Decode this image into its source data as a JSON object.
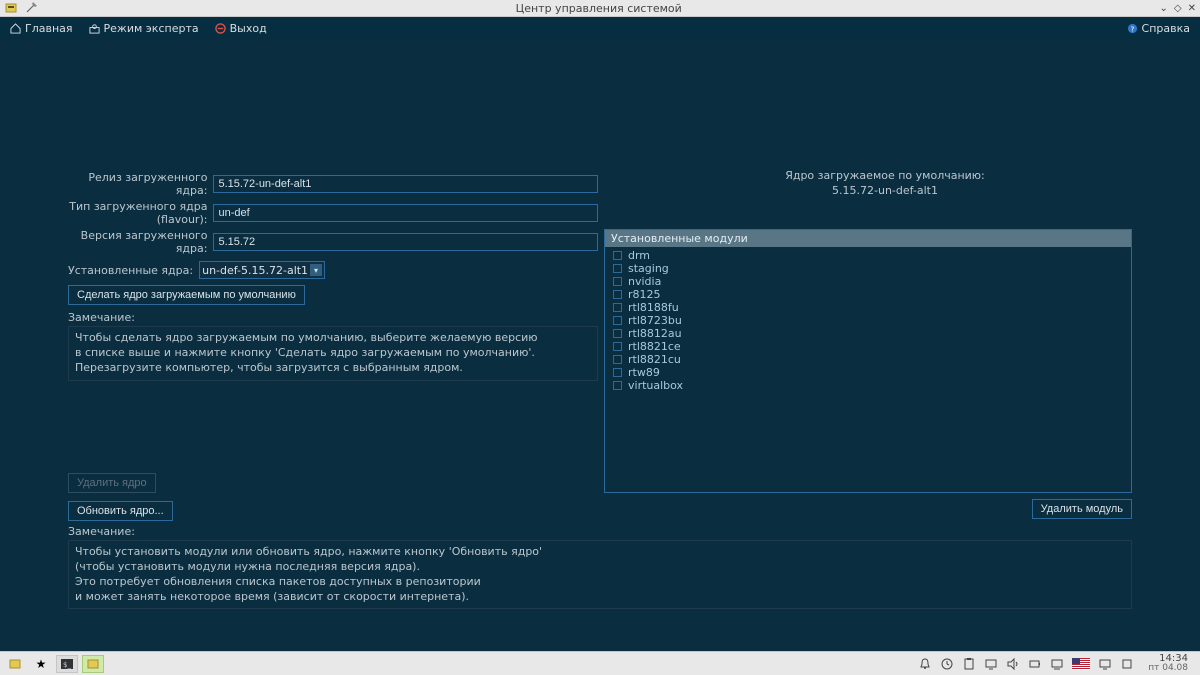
{
  "window": {
    "title": "Центр управления системой"
  },
  "menubar": {
    "home": "Главная",
    "expert": "Режим эксперта",
    "exit": "Выход",
    "help": "Справка"
  },
  "kernel": {
    "release_label": "Релиз загруженного ядра:",
    "release_value": "5.15.72-un-def-alt1",
    "flavour_label": "Тип загруженного ядра (flavour):",
    "flavour_value": "un-def",
    "version_label": "Версия загруженного ядра:",
    "version_value": "5.15.72",
    "installed_label": "Установленные ядра:",
    "installed_selected": "un-def-5.15.72-alt1",
    "make_default": "Сделать ядро загружаемым по умолчанию",
    "note_label": "Замечание:",
    "note_line1": "Чтобы сделать ядро загружаемым по умолчанию, выберите желаемую версию",
    "note_line2": "в списке выше и нажмите кнопку 'Сделать ядро загружаемым по умолчанию'.",
    "note_line3": "Перезагрузите компьютер, чтобы загрузится с выбранным ядром."
  },
  "default_info": {
    "title": "Ядро загружаемое по умолчанию:",
    "value": "5.15.72-un-def-alt1"
  },
  "modules": {
    "header": "Установленные модули",
    "items": [
      "drm",
      "staging",
      "nvidia",
      "r8125",
      "rtl8188fu",
      "rtl8723bu",
      "rtl8812au",
      "rtl8821ce",
      "rtl8821cu",
      "rtw89",
      "virtualbox"
    ]
  },
  "lower": {
    "remove_kernel": "Удалить ядро",
    "update_kernel": "Обновить ядро...",
    "remove_module": "Удалить модуль",
    "note_label": "Замечание:",
    "note_line1": "Чтобы установить модули или обновить ядро, нажмите кнопку 'Обновить ядро'",
    "note_line2": "(чтобы установить модули нужна последняя версия ядра).",
    "note_line3": "Это потребует обновления списка пакетов доступных в репозитории",
    "note_line4": "и может занять некоторое время (зависит от скорости интернета)."
  },
  "taskbar": {
    "time": "14:34",
    "date": "пт 04.08"
  }
}
